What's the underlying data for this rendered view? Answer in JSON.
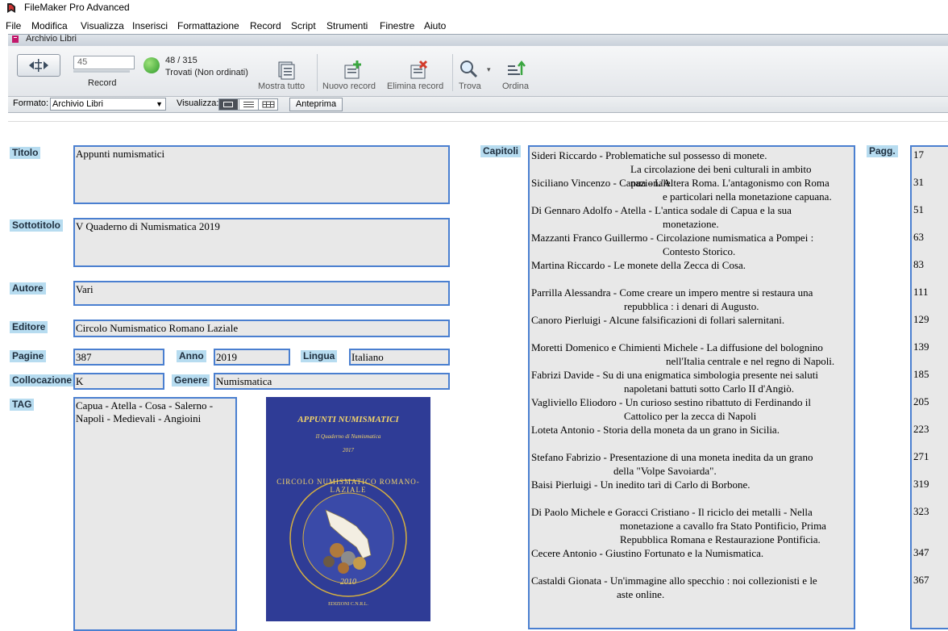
{
  "app": {
    "title": "FileMaker Pro Advanced"
  },
  "menu": [
    "File",
    "Modifica",
    "Visualizza",
    "Inserisci",
    "Formattazione",
    "Record",
    "Script",
    "Strumenti",
    "Finestre",
    "Aiuto"
  ],
  "window": {
    "title": "Archivio Libri"
  },
  "toolbar": {
    "record_value": "45",
    "record_label": "Record",
    "found_count": "48 / 315",
    "found_status": "Trovati (Non ordinati)",
    "show_all": "Mostra tutto",
    "new_record": "Nuovo record",
    "delete_record": "Elimina record",
    "find": "Trova",
    "sort": "Ordina"
  },
  "formatbar": {
    "format_label": "Formato:",
    "format_value": "Archivio Libri",
    "view_label": "Visualizza:",
    "preview": "Anteprima"
  },
  "labels": {
    "titolo": "Titolo",
    "sottotitolo": "Sottotitolo",
    "autore": "Autore",
    "editore": "Editore",
    "pagine": "Pagine",
    "anno": "Anno",
    "lingua": "Lingua",
    "collocazione": "Collocazione",
    "genere": "Genere",
    "tag": "TAG",
    "capitoli": "Capitoli",
    "pagg": "Pagg."
  },
  "record": {
    "titolo": "Appunti numismatici",
    "sottotitolo": "V Quaderno di Numismatica 2019",
    "autore": "Vari",
    "editore": "Circolo Numismatico Romano Laziale",
    "pagine": "387",
    "anno": "2019",
    "lingua": "Italiano",
    "collocazione": "K",
    "genere": "Numismatica",
    "tag_line1": "Capua - Atella - Cosa - Salerno -",
    "tag_line2": "Napoli - Medievali - Angioini"
  },
  "cover": {
    "title": "APPUNTI NUMISMATICI",
    "subtitle": "II Quaderno di Numismatica",
    "year": "2017",
    "ring_text": "CIRCOLO NUMISMATICO ROMANO-LAZIALE",
    "founded": "2010",
    "publisher": "EDIZIONI C.N.R.L."
  },
  "chapters": [
    {
      "line1": "Sideri Riccardo - Problematiche sul possesso di monete.",
      "line2": "La circolazione dei beni culturali in ambito nazionale.",
      "page": "17"
    },
    {
      "line1": "Siciliano Vincenzo - Capua - L'Altera Roma. L'antagonismo con Roma",
      "line2": "e particolari nella monetazione capuana.",
      "page": "31"
    },
    {
      "line1": "Di Gennaro Adolfo - Atella - L'antica sodale di Capua e la sua",
      "line2": "monetazione.",
      "page": "51"
    },
    {
      "line1": "Mazzanti Franco Guillermo - Circolazione numismatica a Pompei :",
      "line2": "Contesto Storico.",
      "page": "63"
    },
    {
      "line1": "Martina Riccardo - Le monete della Zecca di Cosa.",
      "line2": "",
      "page": "83"
    },
    {
      "line1": "Parrilla Alessandra - Come creare un impero mentre si restaura una",
      "line2": "repubblica : i denari di Augusto.",
      "page": "111"
    },
    {
      "line1": "Canoro Pierluigi - Alcune falsificazioni di follari salernitani.",
      "line2": "",
      "page": "129"
    },
    {
      "line1": "Moretti Domenico e Chimienti Michele - La diffusione del bolognino",
      "line2": "nell'Italia centrale e nel regno di Napoli.",
      "page": "139"
    },
    {
      "line1": "Fabrizi Davide - Su di una enigmatica simbologia presente nei saluti",
      "line2": "napoletani battuti sotto Carlo II d'Angiò.",
      "page": "185"
    },
    {
      "line1": "Vagliviello Eliodoro - Un curioso sestino ribattuto di Ferdinando il",
      "line2": "Cattolico per la zecca di Napoli",
      "page": "205"
    },
    {
      "line1": "Loteta Antonio - Storia della moneta da un grano in Sicilia.",
      "line2": "",
      "page": "223"
    },
    {
      "line1": "Stefano Fabrizio - Presentazione di una moneta inedita da un grano",
      "line2": "della \"Volpe Savoiarda\".",
      "page": "271"
    },
    {
      "line1": "Baisi Pierluigi - Un inedito tarì di Carlo di Borbone.",
      "line2": "",
      "page": "319"
    },
    {
      "line1": "Di Paolo Michele e Goracci Cristiano - Il riciclo dei metalli - Nella",
      "line2": "monetazione a cavallo fra Stato Pontificio, Prima",
      "line3": "Repubblica Romana e Restaurazione Pontificia.",
      "page": "323"
    },
    {
      "line1": "Cecere Antonio - Giustino Fortunato e la Numismatica.",
      "line2": "",
      "page": "347"
    },
    {
      "line1": "Castaldi Gionata - Un'immagine allo specchio : noi collezionisti e le",
      "line2": "aste online.",
      "page": "367"
    }
  ]
}
